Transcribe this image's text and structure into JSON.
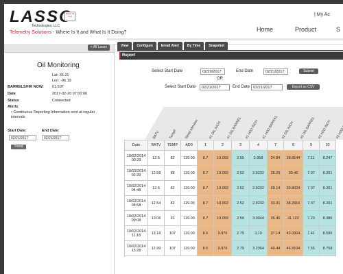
{
  "header": {
    "logo": "LASSO",
    "logo_sub": "Technologies, LLC",
    "flag": "MADE IN USA",
    "tagline_red": "Telemetry Solutions",
    "tagline_rest": " - Where Is It and What Is It Doing?",
    "my_account": "| My Ac",
    "nav": [
      "Home",
      "Product",
      "S"
    ]
  },
  "left": {
    "all_lasso": "< All Lasso",
    "title": "Oil Monitoring",
    "lat": "Lat: 35.21",
    "lon": "Lon: -96.19",
    "barrels_label": "BARRELS/HR NOW:",
    "barrels_val": "61.507",
    "date_label": "Date",
    "date_val": "2017-02-20 07:00:06",
    "status_label": "Status",
    "status_val": "Connected",
    "alerts_label": "Alerts",
    "alert_item": "Continuous Reporting Information sent at regular intervals",
    "start_label": "Start Date:",
    "end_label": "End Date:",
    "start_val": "02/21/2017",
    "end_val": "02/21/2017",
    "trend": "Trend"
  },
  "tabs": [
    "View",
    "Configure",
    "Email Alert",
    "By Time",
    "Snapshot"
  ],
  "report": {
    "heading": "Report",
    "start_label": "Select Start Date",
    "start_val": "02/20/2017",
    "end_label": "End Date",
    "end_val": "02/21/2017",
    "submit": "Submit",
    "or": "OR",
    "start2_label": "Select Start Date",
    "start2_val": "02/21/2017",
    "end2_label": "End Date",
    "end2_val": "02/21/2017",
    "export": "Export as CSV"
  },
  "table": {
    "rot_headers": [
      "BATV",
      "TempF",
      "Sleep Minutes",
      "#1 OIL INCH",
      "#1 OIL BARREL",
      "#1 H2O INCH",
      "#1 H2O BARREL",
      "#2 OIL INCH",
      "#2 OIL BARREL",
      "#2 H2O INCH",
      "#2 H2O B"
    ],
    "columns": [
      "Date",
      "BATV",
      "TEMP",
      "AD0",
      "1",
      "2",
      "3",
      "4",
      "7",
      "8",
      "9",
      "10"
    ],
    "rows": [
      [
        "10/02/2014 00:29",
        "12.6",
        "82",
        "119.00",
        "8.7",
        "10.092",
        "2.55",
        "2.958",
        "24.84",
        "28.8144",
        "7.11",
        "8.247"
      ],
      [
        "10/02/2014 02:39",
        "12.58",
        "88",
        "119.00",
        "8.7",
        "10.092",
        "2.52",
        "2.9232",
        "26.25",
        "30.45",
        "7.07",
        "8.201"
      ],
      [
        "10/02/2014 04:48",
        "12.6",
        "82",
        "119.00",
        "8.7",
        "10.092",
        "2.52",
        "2.9232",
        "29.14",
        "33.8024",
        "7.07",
        "8.201"
      ],
      [
        "10/02/2014 06:58",
        "12.54",
        "82",
        "119.00",
        "8.7",
        "10.092",
        "2.52",
        "2.9232",
        "33.01",
        "38.2916",
        "7.07",
        "8.201"
      ],
      [
        "10/02/2014 09:08",
        "13.06",
        "93",
        "119.00",
        "8.7",
        "10.092",
        "2.59",
        "3.0044",
        "35.45",
        "41.122",
        "7.23",
        "8.386"
      ],
      [
        "10/02/2014 11:18",
        "13.18",
        "107",
        "119.00",
        "8.6",
        "9.976",
        "2.75",
        "3.19",
        "37.14",
        "43.0824",
        "7.41",
        "8.595"
      ],
      [
        "10/02/2014 13:28",
        "12.99",
        "107",
        "119.00",
        "8.6",
        "9.976",
        "2.79",
        "3.2364",
        "40.44",
        "46.9104",
        "7.55",
        "8.758"
      ]
    ]
  }
}
